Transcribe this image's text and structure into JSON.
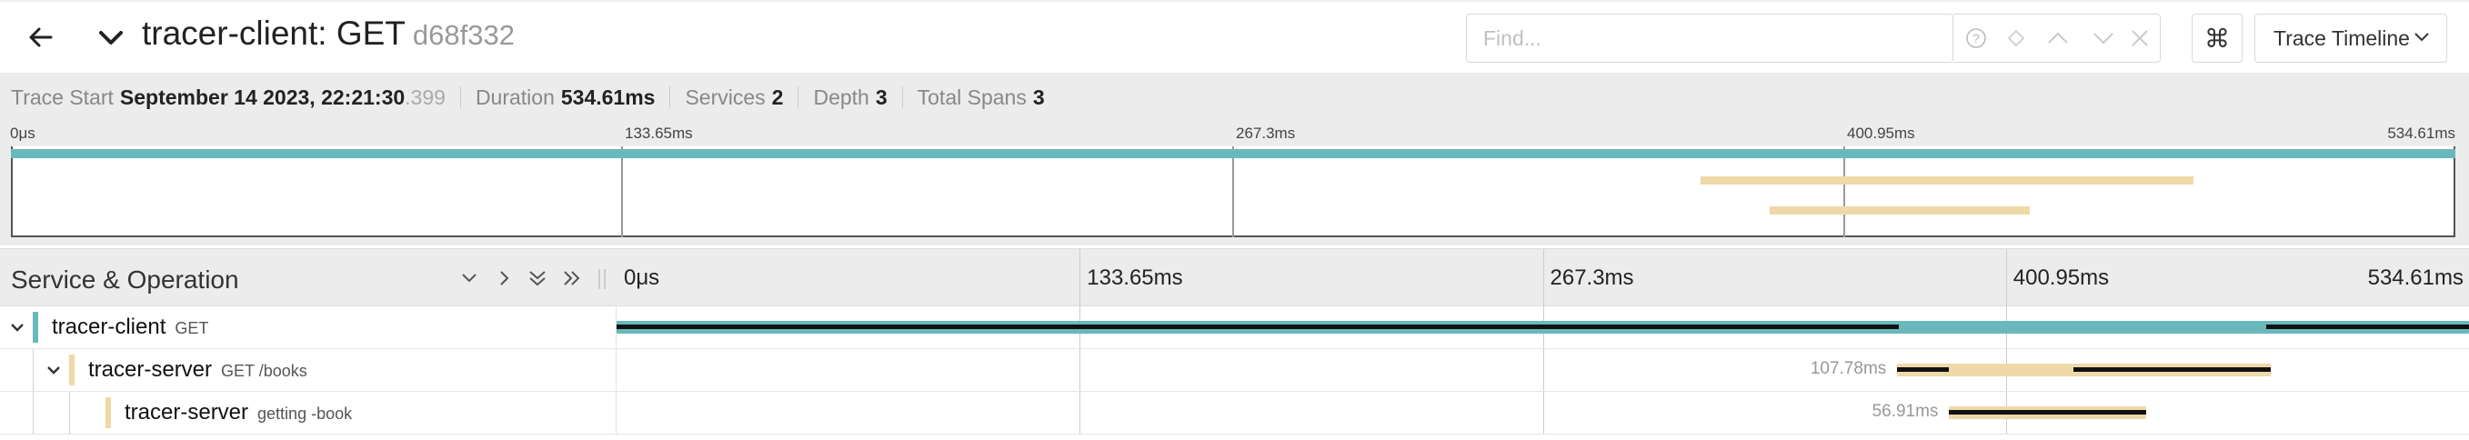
{
  "header": {
    "title": "tracer-client: GET",
    "trace_id": "d68f332",
    "find_placeholder": "Find...",
    "keyboard_shortcut_glyph": "⌘",
    "view_select": "Trace Timeline"
  },
  "summary": {
    "trace_start_label": "Trace Start",
    "trace_start_value": "September 14 2023, 22:21:30",
    "trace_start_ms": ".399",
    "duration_label": "Duration",
    "duration_value": "534.61ms",
    "services_label": "Services",
    "services_value": "2",
    "depth_label": "Depth",
    "depth_value": "3",
    "total_spans_label": "Total Spans",
    "total_spans_value": "3"
  },
  "minimap": {
    "ticks": [
      "0μs",
      "133.65ms",
      "267.3ms",
      "400.95ms",
      "534.61ms"
    ]
  },
  "timeline": {
    "column_title": "Service & Operation",
    "ticks": [
      "0μs",
      "133.65ms",
      "267.3ms",
      "400.95ms",
      "534.61ms"
    ],
    "total_ms": 534.61
  },
  "colors": {
    "client": "#69b9bc",
    "server": "#efd9a8",
    "self_time": "#111111"
  },
  "spans": [
    {
      "service": "tracer-client",
      "operation": "GET",
      "depth": 0,
      "start_ms": 0,
      "duration_ms": 534.61,
      "duration_label": "",
      "color": "client",
      "self_segments": [
        [
          0,
          370
        ],
        [
          476,
          534.61
        ]
      ]
    },
    {
      "service": "tracer-server",
      "operation": "GET /books",
      "depth": 1,
      "start_ms": 369.6,
      "duration_ms": 107.78,
      "duration_label": "107.78ms",
      "color": "server",
      "self_segments": [
        [
          369.6,
          384.6
        ],
        [
          420.5,
          477.38
        ]
      ]
    },
    {
      "service": "tracer-server",
      "operation": "getting -book",
      "depth": 2,
      "start_ms": 384.6,
      "duration_ms": 56.91,
      "duration_label": "56.91ms",
      "color": "server",
      "self_segments": [
        [
          384.6,
          441.51
        ]
      ]
    }
  ]
}
